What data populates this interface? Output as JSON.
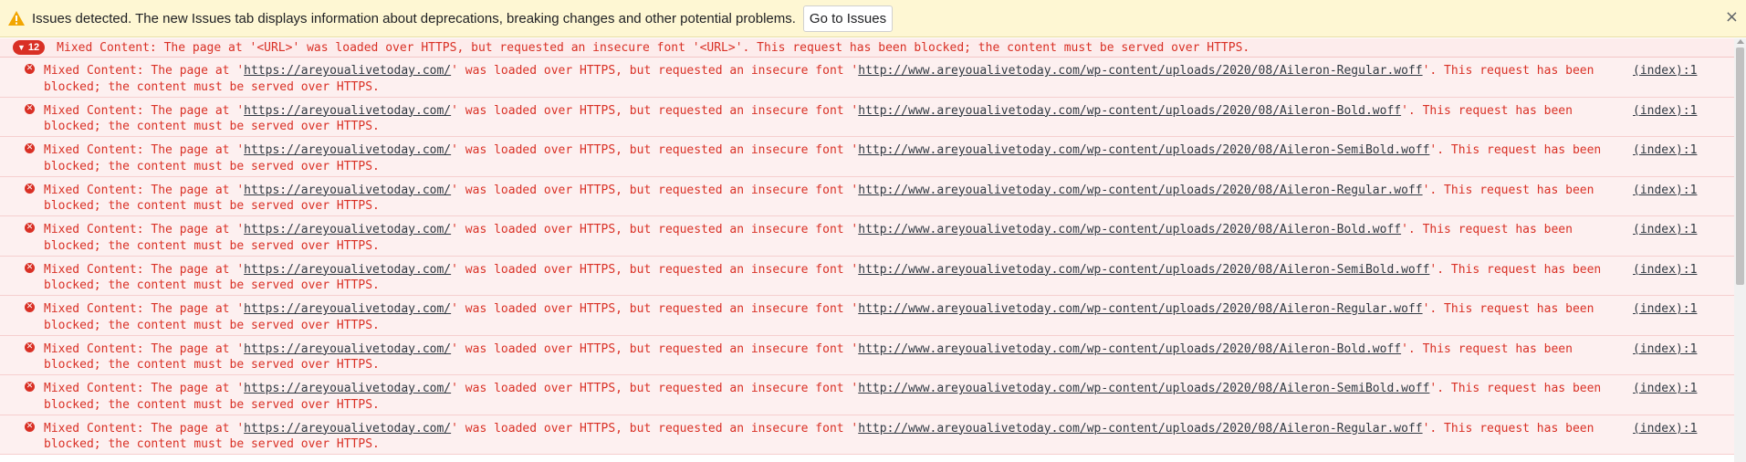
{
  "banner": {
    "message": "Issues detected. The new Issues tab displays information about deprecations, breaking changes and other potential problems.",
    "button": "Go to Issues",
    "close": "×"
  },
  "group": {
    "count": "12",
    "text": "Mixed Content: The page at '<URL>' was loaded over HTTPS, but requested an insecure font '<URL>'. This request has been blocked; the content must be served over HTTPS."
  },
  "colors": {
    "error": "#d93025",
    "warning_bg": "#fef7d3",
    "row_bg": "#fdf0f0"
  },
  "rows": [
    {
      "pre": "Mixed Content: The page at '",
      "page_url": "https://areyoualivetoday.com/",
      "mid": "' was loaded over HTTPS, but requested an insecure font '",
      "font_url": "http://www.areyoualivetoday.com/wp-content/uploads/2020/08/Aileron-Regular.woff",
      "post": "'. This request has been blocked; the content must be served over HTTPS.",
      "source": "(index):1"
    },
    {
      "pre": "Mixed Content: The page at '",
      "page_url": "https://areyoualivetoday.com/",
      "mid": "' was loaded over HTTPS, but requested an insecure font '",
      "font_url": "http://www.areyoualivetoday.com/wp-content/uploads/2020/08/Aileron-Bold.woff",
      "post": "'. This request has been blocked; the content must be served over HTTPS.",
      "source": "(index):1"
    },
    {
      "pre": "Mixed Content: The page at '",
      "page_url": "https://areyoualivetoday.com/",
      "mid": "' was loaded over HTTPS, but requested an insecure font '",
      "font_url": "http://www.areyoualivetoday.com/wp-content/uploads/2020/08/Aileron-SemiBold.woff",
      "post": "'. This request has been blocked; the content must be served over HTTPS.",
      "source": "(index):1"
    },
    {
      "pre": "Mixed Content: The page at '",
      "page_url": "https://areyoualivetoday.com/",
      "mid": "' was loaded over HTTPS, but requested an insecure font '",
      "font_url": "http://www.areyoualivetoday.com/wp-content/uploads/2020/08/Aileron-Regular.woff",
      "post": "'. This request has been blocked; the content must be served over HTTPS.",
      "source": "(index):1"
    },
    {
      "pre": "Mixed Content: The page at '",
      "page_url": "https://areyoualivetoday.com/",
      "mid": "' was loaded over HTTPS, but requested an insecure font '",
      "font_url": "http://www.areyoualivetoday.com/wp-content/uploads/2020/08/Aileron-Bold.woff",
      "post": "'. This request has been blocked; the content must be served over HTTPS.",
      "source": "(index):1"
    },
    {
      "pre": "Mixed Content: The page at '",
      "page_url": "https://areyoualivetoday.com/",
      "mid": "' was loaded over HTTPS, but requested an insecure font '",
      "font_url": "http://www.areyoualivetoday.com/wp-content/uploads/2020/08/Aileron-SemiBold.woff",
      "post": "'. This request has been blocked; the content must be served over HTTPS.",
      "source": "(index):1"
    },
    {
      "pre": "Mixed Content: The page at '",
      "page_url": "https://areyoualivetoday.com/",
      "mid": "' was loaded over HTTPS, but requested an insecure font '",
      "font_url": "http://www.areyoualivetoday.com/wp-content/uploads/2020/08/Aileron-Regular.woff",
      "post": "'. This request has been blocked; the content must be served over HTTPS.",
      "source": "(index):1"
    },
    {
      "pre": "Mixed Content: The page at '",
      "page_url": "https://areyoualivetoday.com/",
      "mid": "' was loaded over HTTPS, but requested an insecure font '",
      "font_url": "http://www.areyoualivetoday.com/wp-content/uploads/2020/08/Aileron-Bold.woff",
      "post": "'. This request has been blocked; the content must be served over HTTPS.",
      "source": "(index):1"
    },
    {
      "pre": "Mixed Content: The page at '",
      "page_url": "https://areyoualivetoday.com/",
      "mid": "' was loaded over HTTPS, but requested an insecure font '",
      "font_url": "http://www.areyoualivetoday.com/wp-content/uploads/2020/08/Aileron-SemiBold.woff",
      "post": "'. This request has been blocked; the content must be served over HTTPS.",
      "source": "(index):1"
    },
    {
      "pre": "Mixed Content: The page at '",
      "page_url": "https://areyoualivetoday.com/",
      "mid": "' was loaded over HTTPS, but requested an insecure font '",
      "font_url": "http://www.areyoualivetoday.com/wp-content/uploads/2020/08/Aileron-Regular.woff",
      "post": "'. This request has been blocked; the content must be served over HTTPS.",
      "source": "(index):1"
    }
  ]
}
